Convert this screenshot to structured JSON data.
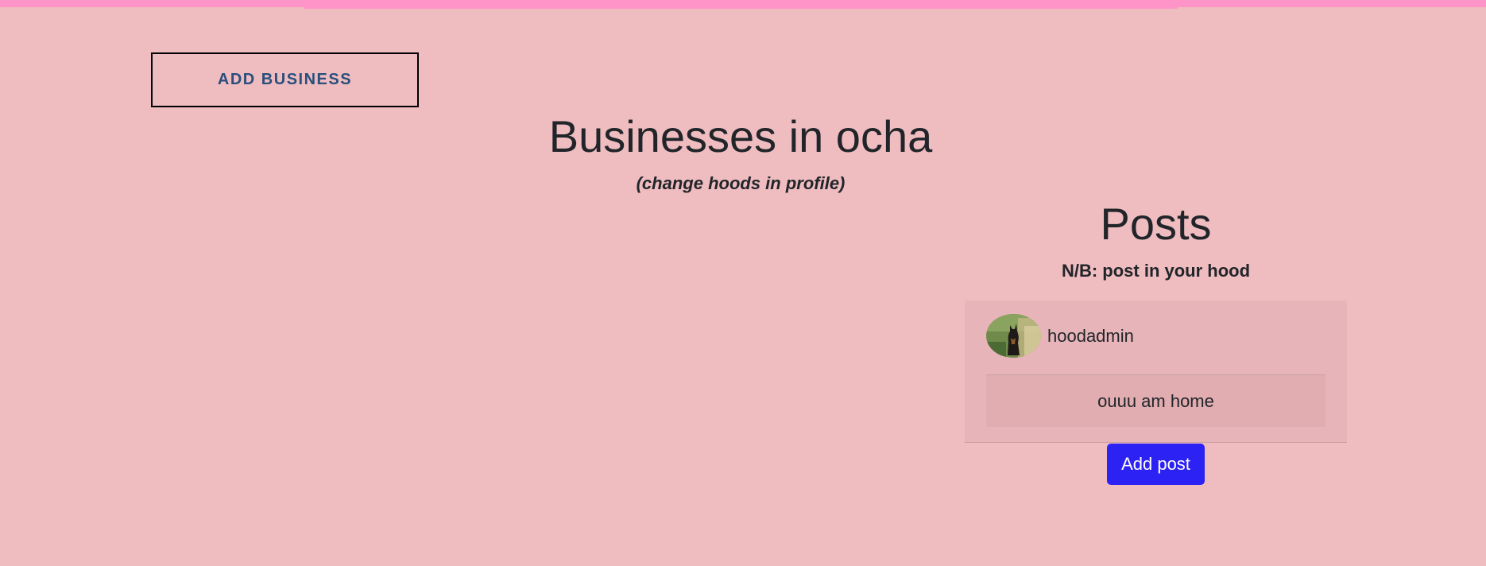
{
  "header": {
    "add_business_label": "ADD BUSINESS"
  },
  "main": {
    "title": "Businesses in ocha",
    "subtitle": "(change hoods in profile)"
  },
  "posts": {
    "title": "Posts",
    "note": "N/B: post in your hood",
    "items": [
      {
        "author": "hoodadmin",
        "avatar": "dog-photo-avatar",
        "content": "ouuu am home"
      }
    ],
    "add_post_label": "Add post"
  },
  "colors": {
    "background": "#efbcc0",
    "top_bar": "#ff94c8",
    "button_primary": "#2d22f4",
    "add_business_text": "#2a4f7c"
  }
}
